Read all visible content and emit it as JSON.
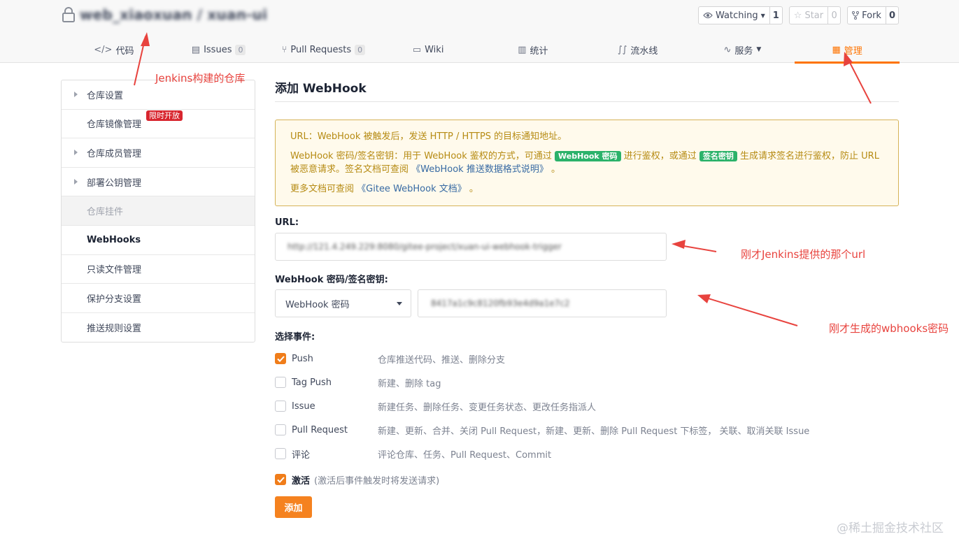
{
  "repo": {
    "title": "web_xiaoxuan / xuan-ui",
    "actions": [
      {
        "label": "Watching",
        "icon": "eye-icon",
        "count": "1",
        "has_caret": true
      },
      {
        "label": "Star",
        "icon": "star-icon",
        "count": "0",
        "disabled": true
      },
      {
        "label": "Fork",
        "icon": "fork-icon",
        "count": "0"
      }
    ]
  },
  "tabs": [
    {
      "label": "代码",
      "icon": "code-icon"
    },
    {
      "label": "Issues",
      "icon": "issues-icon",
      "count": "0"
    },
    {
      "label": "Pull Requests",
      "icon": "pull-request-icon",
      "count": "0"
    },
    {
      "label": "Wiki",
      "icon": "wiki-icon"
    },
    {
      "label": "统计",
      "icon": "chart-icon"
    },
    {
      "label": "流水线",
      "icon": "pipeline-icon"
    },
    {
      "label": "服务",
      "icon": "pulse-icon"
    },
    {
      "label": "管理",
      "icon": "manage-icon",
      "active": true
    }
  ],
  "sidebar": {
    "items": [
      {
        "label": "仓库设置",
        "arrow": true
      },
      {
        "label": "仓库镜像管理",
        "badge": "限时开放"
      },
      {
        "label": "仓库成员管理",
        "arrow": true
      },
      {
        "label": "部署公钥管理",
        "arrow": true
      },
      {
        "label": "仓库挂件",
        "disabled": true
      },
      {
        "label": "WebHooks",
        "active": true
      },
      {
        "label": "只读文件管理"
      },
      {
        "label": "保护分支设置"
      },
      {
        "label": "推送规则设置"
      }
    ]
  },
  "main": {
    "title": "添加 WebHook",
    "notice": {
      "line1": "URL：WebHook 被触发后，发送 HTTP / HTTPS 的目标通知地址。",
      "line2_a": "WebHook 密码/签名密钥：用于 WebHook 鉴权的方式，可通过",
      "tag1": "WebHook 密码",
      "line2_b": "进行鉴权，或通过",
      "tag2": "签名密钥",
      "line2_c": "生成请求签名进行鉴权，防止 URL 被恶意请求。签名文档可查阅",
      "link1": "《WebHook 推送数据格式说明》",
      "line2_end": "。",
      "line3_a": "更多文档可查阅",
      "link2": "《Gitee WebHook 文档》",
      "line3_end": "。"
    },
    "url_label": "URL:",
    "url_value": "http://121.4.249.229:8080/gitee-project/xuan-ui-webhook-trigger",
    "password_label": "WebHook 密码/签名密钥:",
    "password_type": "WebHook 密码",
    "password_value": "8417a1c9c8120fb93e4d9a1e7c2",
    "events_label": "选择事件:",
    "events": [
      {
        "name": "Push",
        "desc": "仓库推送代码、推送、删除分支",
        "checked": true
      },
      {
        "name": "Tag Push",
        "desc": "新建、删除 tag",
        "checked": false
      },
      {
        "name": "Issue",
        "desc": "新建任务、删除任务、变更任务状态、更改任务指派人",
        "checked": false
      },
      {
        "name": "Pull Request",
        "desc": "新建、更新、合并、关闭 Pull Request，新建、更新、删除 Pull Request 下标签， 关联、取消关联 Issue",
        "checked": false
      },
      {
        "name": "评论",
        "desc": "评论仓库、任务、Pull Request、Commit",
        "checked": false
      }
    ],
    "active_label": "激活",
    "active_hint": "(激活后事件触发时将发送请求)",
    "active_checked": true,
    "add_button": "添加"
  },
  "annotations": {
    "repo_note": "Jenkins构建的仓库",
    "url_note": "刚才Jenkins提供的那个url",
    "secret_note": "刚才生成的wbhooks密码",
    "color": "#e8433e"
  },
  "watermark": "@稀土掘金技术社区",
  "colors": {
    "accent": "#fe7300",
    "notice_text": "#b68b13",
    "tag_green": "#2bb26a",
    "badge_red": "#d8262f"
  }
}
